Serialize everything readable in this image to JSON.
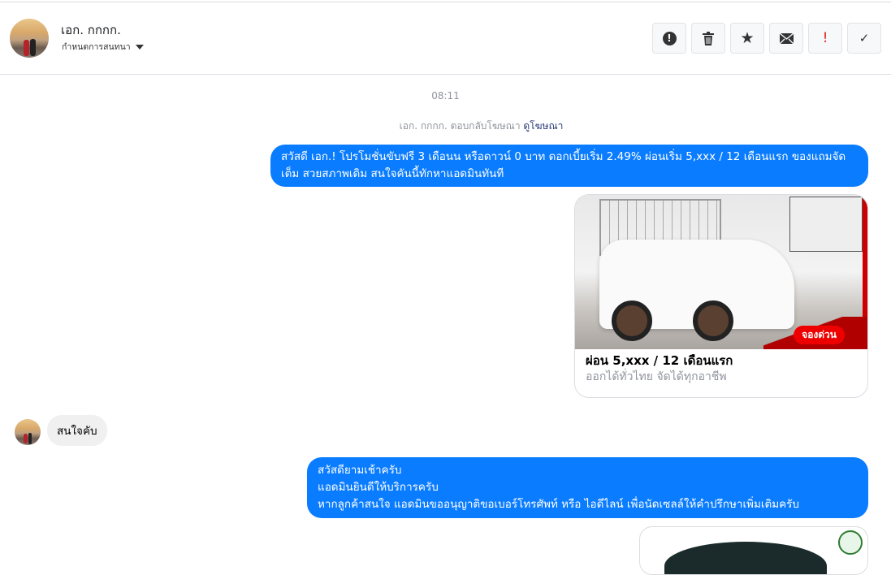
{
  "header": {
    "name": "เอก. กกกก.",
    "subtitle": "กำหนดการสนทนา",
    "actions": [
      {
        "icon": "alert-circle-icon",
        "glyph": "⬤"
      },
      {
        "icon": "trash-icon",
        "glyph": "🗑"
      },
      {
        "icon": "star-icon",
        "glyph": "★"
      },
      {
        "icon": "mail-icon",
        "glyph": "✉"
      },
      {
        "icon": "exclamation-icon",
        "glyph": "!"
      },
      {
        "icon": "check-icon",
        "glyph": "✓"
      }
    ]
  },
  "thread": {
    "timestamp": "08:11",
    "reply_note": "เอก. กกกก. ตอบกลับโฆษณา",
    "reply_link": "ดูโฆษณา",
    "msg1": "สวัสดี เอก.! โปรโมชั่นขับฟรี 3 เดือนน หรือดาวน์ 0 บาท ดอกเบี้ยเริ่ม 2.49% ผ่อนเริ่ม 5,xxx / 12 เดือนแรก ของแถมจัดเต็ม สวยสภาพเดิม สนใจคันนี้ทักหาแอดมินทันที",
    "card": {
      "image_badge": "จองด่วน",
      "title": "ผ่อน 5,xxx / 12 เดือนแรก",
      "subtitle": "ออกได้ทั่วไทย จัดได้ทุกอาชีพ"
    },
    "msg2": "สนใจคับ",
    "msg3_lines": [
      "สวัสดียามเช้าครับ",
      "แอดมินยินดีให้บริการครับ",
      "หากลูกค้าสนใจ แอดมินขออนุญาติขอเบอร์โทรศัพท์ หรือ ไอดีไลน์ เพื่อนัดเซลล์ให้คำปรึกษาเพิ่มเติมครับ"
    ]
  }
}
